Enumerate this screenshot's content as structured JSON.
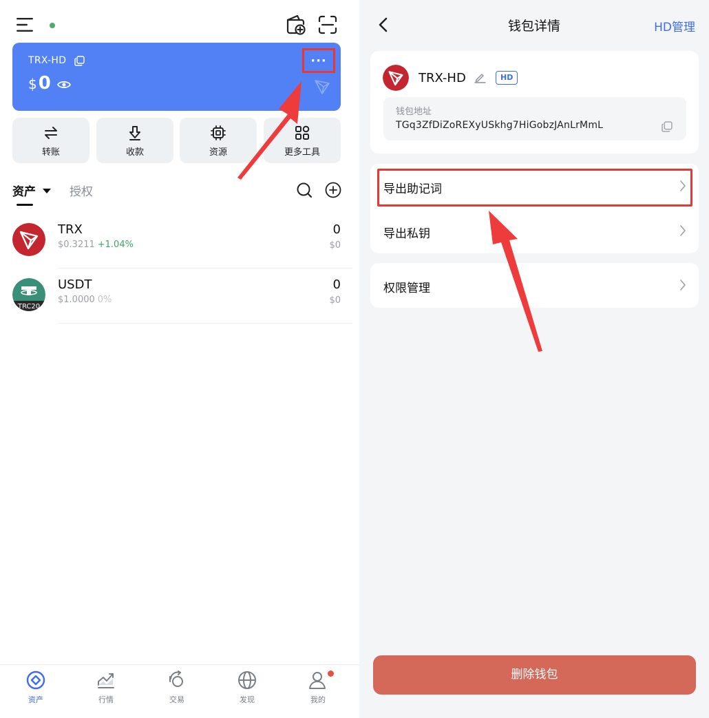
{
  "left_panel": {
    "card": {
      "wallet_name": "TRX-HD",
      "currency": "$",
      "balance": "0",
      "more_label": "···"
    },
    "actions": [
      {
        "label": "转账",
        "icon": "transfer-icon"
      },
      {
        "label": "收款",
        "icon": "receive-icon"
      },
      {
        "label": "资源",
        "icon": "chip-icon"
      },
      {
        "label": "更多工具",
        "icon": "grid-icon"
      }
    ],
    "tabs": {
      "assets": "资产",
      "authorization": "授权"
    },
    "tokens": [
      {
        "symbol": "TRX",
        "price": "$0.3211",
        "change": "+1.04%",
        "amount": "0",
        "value": "$0"
      },
      {
        "symbol": "USDT",
        "price": "$1.0000",
        "change": "0%",
        "amount": "0",
        "value": "$0",
        "badge": "TRC20"
      }
    ],
    "bottom_nav": [
      {
        "label": "资产",
        "icon": "assets-icon",
        "active": true
      },
      {
        "label": "行情",
        "icon": "market-icon"
      },
      {
        "label": "交易",
        "icon": "trade-icon"
      },
      {
        "label": "发现",
        "icon": "globe-icon"
      },
      {
        "label": "我的",
        "icon": "profile-icon",
        "has_badge": true
      }
    ]
  },
  "right_panel": {
    "header": {
      "title": "钱包详情",
      "action": "HD管理"
    },
    "wallet": {
      "name": "TRX-HD",
      "badge": "HD",
      "address_label": "钱包地址",
      "address": "TGq3ZfDiZoREXyUSkhg7HiGobzJAnLrMmL"
    },
    "menu": [
      {
        "label": "导出助记词"
      },
      {
        "label": "导出私钥"
      },
      {
        "label": "权限管理"
      }
    ],
    "delete_button": "删除钱包"
  },
  "colors": {
    "card_blue": "#5281f5",
    "accent_blue": "#3d6cf0",
    "positive_green": "#3ea66a",
    "tron_red": "#c3262f",
    "tether_teal": "#3a8f78",
    "delete_red": "#d4695a",
    "highlight_red": "#e53935"
  }
}
